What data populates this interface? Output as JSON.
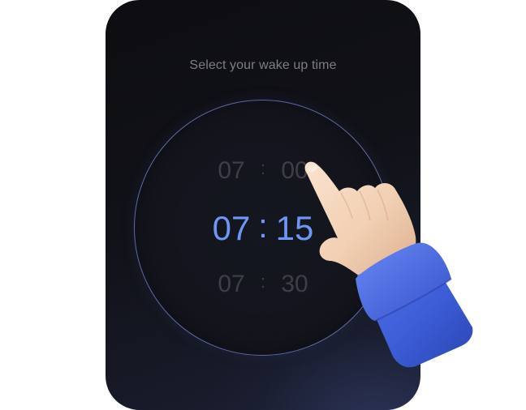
{
  "prompt": "Select your wake up time",
  "picker": {
    "rows": [
      {
        "hour": "07",
        "separator": ":",
        "minute": "00",
        "state": "dimmed"
      },
      {
        "hour": "07",
        "separator": ":",
        "minute": "15",
        "state": "selected"
      },
      {
        "hour": "07",
        "separator": ":",
        "minute": "30",
        "state": "dimmed"
      }
    ]
  },
  "colors": {
    "selected": "#6e96f4",
    "dimmed": "#3d3f47",
    "ring": "#5b6aa6",
    "sleeve": "#3b5cd6"
  },
  "icons": {
    "pointer": "pointing-hand-icon"
  }
}
